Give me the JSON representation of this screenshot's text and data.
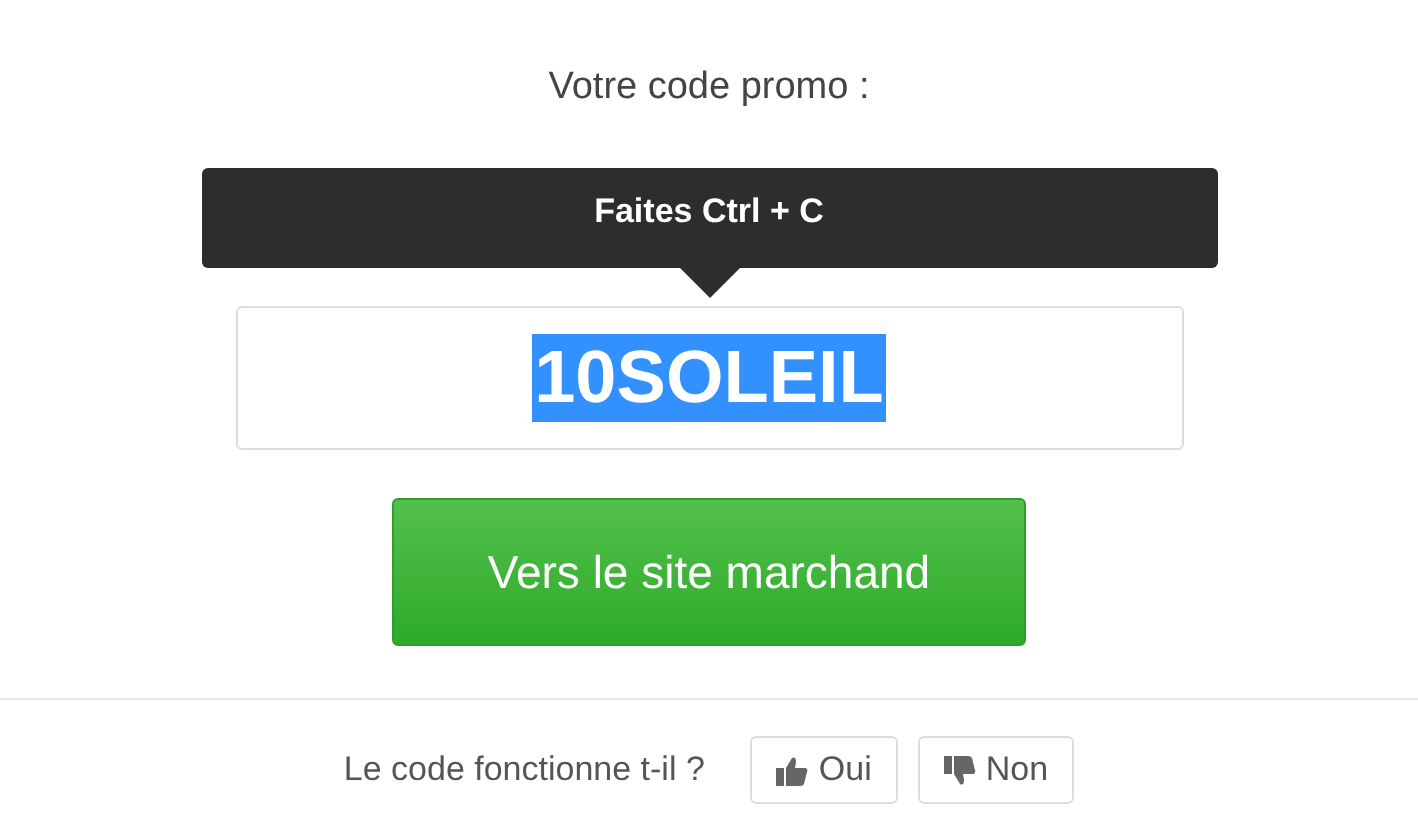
{
  "heading": "Votre code promo :",
  "tooltip": "Faites Ctrl + C",
  "code": {
    "value": "10SOLEIL",
    "selected": true
  },
  "cta": "Vers le site marchand",
  "feedback": {
    "question": "Le code fonctionne t-il ?",
    "votes": [
      {
        "kind": "up",
        "label": "Oui"
      },
      {
        "kind": "down",
        "label": "Non"
      }
    ]
  }
}
